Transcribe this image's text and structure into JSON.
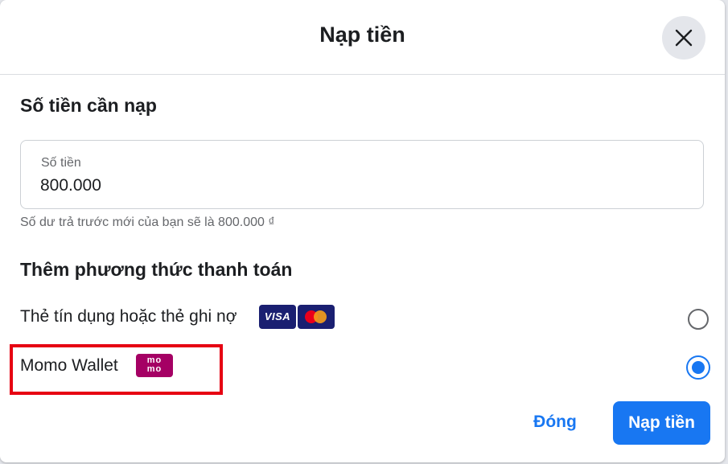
{
  "dialog": {
    "title": "Nạp tiền",
    "close_icon": "close-icon"
  },
  "amount_section": {
    "title": "Số tiền cần nạp",
    "field_label": "Số tiền",
    "field_value": "800.000",
    "balance_note": "Số dư trả trước mới của bạn sẽ là 800.000 ₫"
  },
  "payment_section": {
    "title": "Thêm phương thức thanh toán",
    "options": [
      {
        "label": "Thẻ tín dụng hoặc thẻ ghi nợ",
        "logos": [
          "visa-icon",
          "mastercard-icon"
        ],
        "visa_text": "VISA",
        "selected": false
      },
      {
        "label": "Momo Wallet",
        "logos": [
          "momo-icon"
        ],
        "momo_text": "mo mo",
        "selected": true
      }
    ]
  },
  "footer": {
    "cancel_label": "Đóng",
    "submit_label": "Nạp tiền"
  },
  "colors": {
    "accent": "#1877f2",
    "highlight": "#e60012",
    "momo": "#a50064",
    "visa": "#1a1f71"
  }
}
